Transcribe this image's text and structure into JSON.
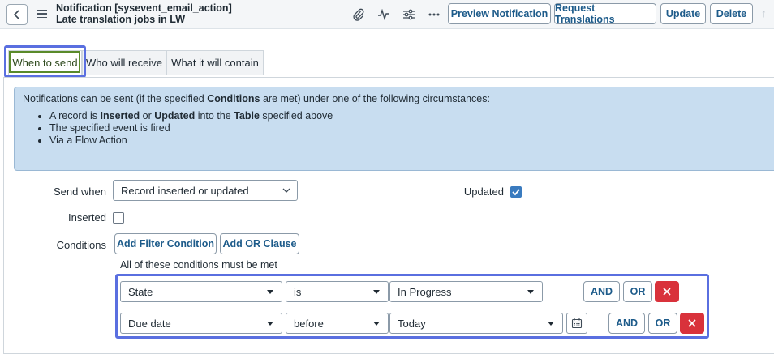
{
  "header": {
    "title_line1": "Notification [sysevent_email_action]",
    "title_line2": "Late translation jobs in LW",
    "buttons": {
      "preview": "Preview Notification",
      "request_translations": "Request Translations",
      "update": "Update",
      "delete": "Delete"
    }
  },
  "tabs": [
    {
      "label": "When to send",
      "active": true
    },
    {
      "label": "Who will receive",
      "active": false
    },
    {
      "label": "What it will contain",
      "active": false
    }
  ],
  "info": {
    "intro_pre": "Notifications can be sent (if the specified ",
    "intro_bold": "Conditions",
    "intro_post": " are met) under one of the following circumstances:",
    "bullet1_a": "A record is ",
    "bullet1_b": "Inserted",
    "bullet1_c": " or ",
    "bullet1_d": "Updated",
    "bullet1_e": " into the ",
    "bullet1_f": "Table",
    "bullet1_g": " specified above",
    "bullet2": "The specified event is fired",
    "bullet3": "Via a Flow Action"
  },
  "form": {
    "send_when_label": "Send when",
    "send_when_value": "Record inserted or updated",
    "updated_label": "Updated",
    "updated_checked": true,
    "inserted_label": "Inserted",
    "inserted_checked": false,
    "conditions_label": "Conditions",
    "add_filter_condition": "Add Filter Condition",
    "add_or_clause": "Add OR Clause",
    "conditions_note": "All of these conditions must be met"
  },
  "conditions": [
    {
      "field": "State",
      "operator": "is",
      "value": "In Progress",
      "and": "AND",
      "or": "OR"
    },
    {
      "field": "Due date",
      "operator": "before",
      "value": "Today",
      "and": "AND",
      "or": "OR"
    }
  ],
  "colors": {
    "accent": "#1d5b8a",
    "highlight": "#5a6fe0",
    "delete": "#d9323b",
    "info_bg": "#c8ddf0"
  }
}
